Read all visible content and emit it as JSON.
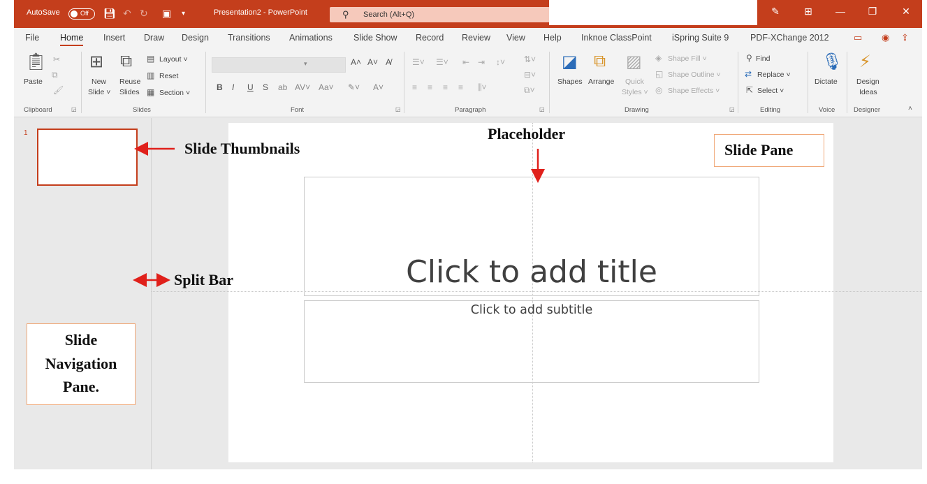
{
  "titlebar": {
    "autosave_label": "AutoSave",
    "autosave_state": "Off",
    "file_title": "Presentation2 - PowerPoint",
    "search_placeholder": "Search (Alt+Q)"
  },
  "tabs": [
    "File",
    "Home",
    "Insert",
    "Draw",
    "Design",
    "Transitions",
    "Animations",
    "Slide Show",
    "Record",
    "Review",
    "View",
    "Help",
    "Inknoe ClassPoint",
    "iSpring Suite 9",
    "PDF-XChange 2012"
  ],
  "active_tab": "Home",
  "ribbon": {
    "clipboard": {
      "label": "Clipboard",
      "paste": "Paste"
    },
    "slides": {
      "label": "Slides",
      "new_slide_1": "New",
      "new_slide_2": "Slide ˅",
      "reuse_1": "Reuse",
      "reuse_2": "Slides",
      "layout": "Layout ˅",
      "reset": "Reset",
      "section": "Section ˅"
    },
    "font": {
      "label": "Font",
      "bold": "B",
      "italic": "I",
      "underline": "U",
      "strike": "S",
      "grow": "A˄",
      "shrink": "A˅"
    },
    "paragraph": {
      "label": "Paragraph"
    },
    "drawing": {
      "label": "Drawing",
      "shapes": "Shapes",
      "arrange": "Arrange",
      "quick_styles_1": "Quick",
      "quick_styles_2": "Styles ˅",
      "shape_fill": "Shape Fill ˅",
      "shape_outline": "Shape Outline ˅",
      "shape_effects": "Shape Effects ˅"
    },
    "editing": {
      "label": "Editing",
      "find": "Find",
      "replace": "Replace ˅",
      "select": "Select ˅"
    },
    "voice": {
      "label": "Voice",
      "dictate": "Dictate"
    },
    "designer": {
      "label": "Designer",
      "design_ideas_1": "Design",
      "design_ideas_2": "Ideas"
    }
  },
  "thumbnails": {
    "slide_number": "1"
  },
  "slide": {
    "title_placeholder": "Click to add title",
    "subtitle_placeholder": "Click to add subtitle"
  },
  "annotations": {
    "slide_thumbnails": "Slide Thumbnails",
    "placeholder": "Placeholder",
    "slide_pane": "Slide Pane",
    "split_bar": "Split Bar",
    "nav_pane_line1": "Slide",
    "nav_pane_line2": "Navigation",
    "nav_pane_line3": "Pane."
  },
  "colors": {
    "accent": "#c43e1c",
    "annotation_arrow": "#e0201b",
    "annotation_box_border": "#f0a878"
  }
}
